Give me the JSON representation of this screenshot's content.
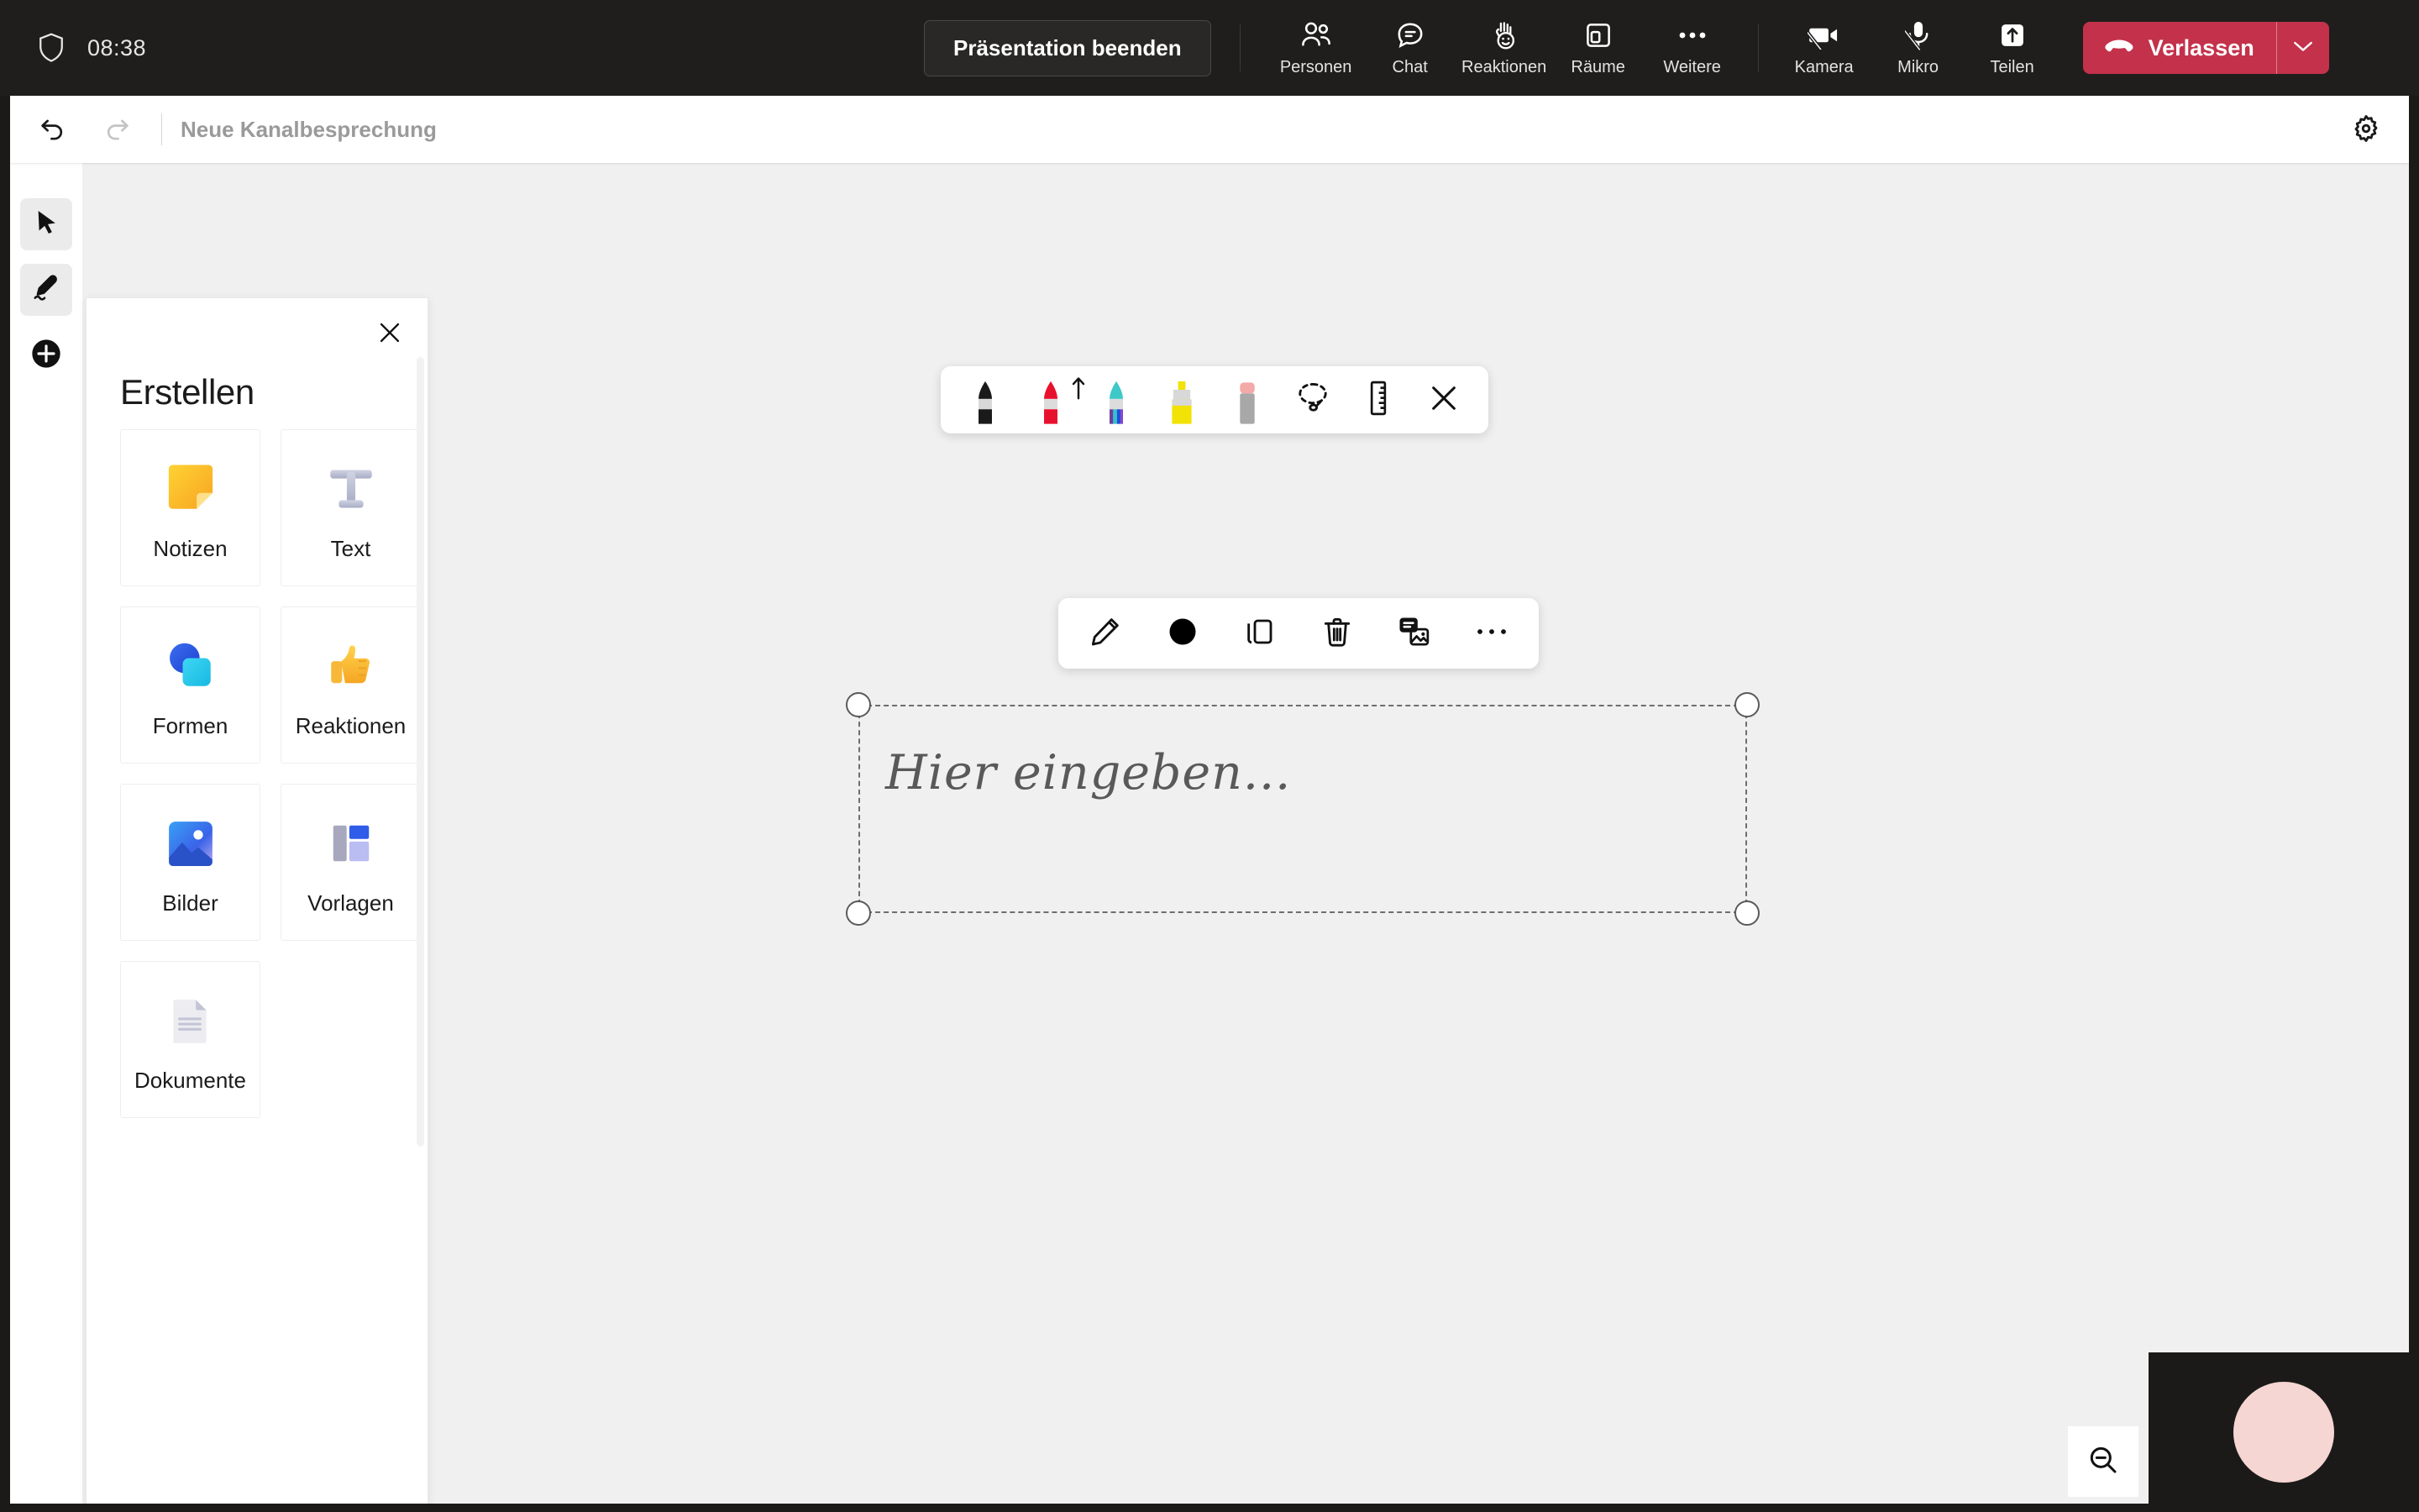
{
  "meeting_bar": {
    "shield_icon": "shield-icon",
    "time": "08:38",
    "end_presentation_label": "Präsentation beenden",
    "controls": [
      {
        "icon": "people-icon",
        "label": "Personen"
      },
      {
        "icon": "chat-icon",
        "label": "Chat"
      },
      {
        "icon": "reactions-icon",
        "label": "Reaktionen"
      },
      {
        "icon": "rooms-icon",
        "label": "Räume"
      },
      {
        "icon": "more-icon",
        "label": "Weitere"
      }
    ],
    "device_controls": [
      {
        "icon": "camera-off-icon",
        "label": "Kamera"
      },
      {
        "icon": "mic-off-icon",
        "label": "Mikro"
      },
      {
        "icon": "share-icon",
        "label": "Teilen"
      }
    ],
    "leave": {
      "label": "Verlassen",
      "icon": "hangup-icon",
      "caret_icon": "chevron-down-icon",
      "color": "#c4314b"
    }
  },
  "whiteboard_header": {
    "undo_icon": "undo-icon",
    "redo_icon": "redo-icon",
    "title": "Neue Kanalbesprechung",
    "settings_icon": "gear-icon"
  },
  "tool_rail": {
    "items": [
      {
        "icon": "cursor-icon",
        "name": "select-tool",
        "active": true
      },
      {
        "icon": "pen-icon",
        "name": "ink-tool",
        "active": true
      },
      {
        "icon": "plus-icon",
        "name": "create-tool",
        "active": false
      }
    ]
  },
  "create_panel": {
    "title": "Erstellen",
    "close_icon": "close-icon",
    "cards": [
      {
        "label": "Notizen",
        "icon": "sticky-note-icon"
      },
      {
        "label": "Text",
        "icon": "text-t-icon"
      },
      {
        "label": "Formen",
        "icon": "shapes-icon"
      },
      {
        "label": "Reaktionen",
        "icon": "thumbs-up-icon"
      },
      {
        "label": "Bilder",
        "icon": "image-icon"
      },
      {
        "label": "Vorlagen",
        "icon": "templates-icon"
      },
      {
        "label": "Dokumente",
        "icon": "document-icon"
      }
    ]
  },
  "pen_toolbar": {
    "pens": [
      {
        "name": "pen-black",
        "color": "#1a1a1a"
      },
      {
        "name": "pen-red",
        "color": "#e8112d"
      },
      {
        "name": "pen-rainbow",
        "color": "#6b3fa0"
      },
      {
        "name": "highlighter-yellow",
        "color": "#f2e205"
      },
      {
        "name": "eraser",
        "color": "#f4a9a9"
      }
    ],
    "tools": [
      {
        "name": "lasso-select-icon"
      },
      {
        "name": "ruler-icon"
      },
      {
        "name": "close-icon"
      }
    ]
  },
  "context_toolbar": {
    "buttons": [
      {
        "name": "edit-pencil-icon"
      },
      {
        "name": "color-swatch-icon",
        "color": "#000000"
      },
      {
        "name": "duplicate-icon"
      },
      {
        "name": "delete-trash-icon"
      },
      {
        "name": "convert-to-image-icon"
      },
      {
        "name": "more-options-icon"
      }
    ]
  },
  "canvas": {
    "text_object": {
      "placeholder": "Hier eingeben...",
      "selected": true,
      "handles": 4
    },
    "background_color": "#f0f0f0"
  },
  "zoom_control": {
    "icon": "zoom-out-icon"
  },
  "video_tile": {
    "avatar_color": "#f6d6d2",
    "background_color": "#1b1a19"
  }
}
